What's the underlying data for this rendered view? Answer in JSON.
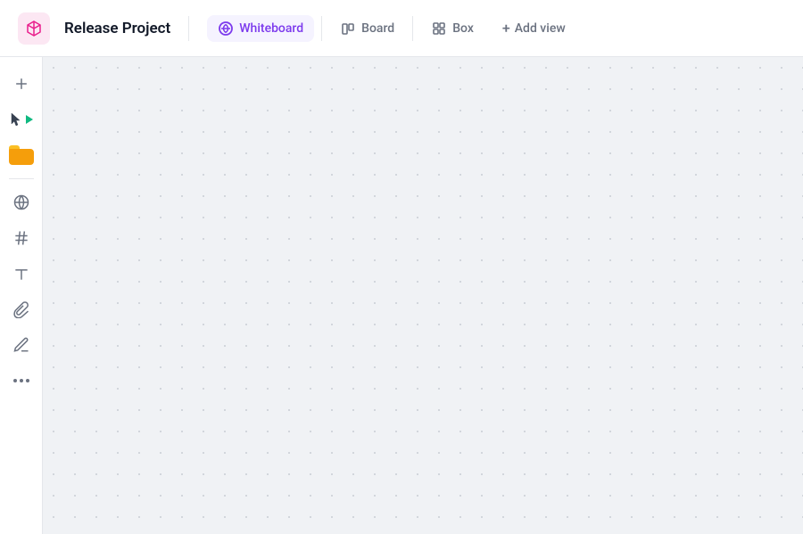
{
  "header": {
    "project_icon_alt": "release-project-icon",
    "project_title": "Release Project",
    "tabs": [
      {
        "id": "whiteboard",
        "label": "Whiteboard",
        "active": true
      },
      {
        "id": "board",
        "label": "Board",
        "active": false
      },
      {
        "id": "box",
        "label": "Box",
        "active": false
      }
    ],
    "add_view_label": "Add view"
  },
  "sidebar": {
    "tools": [
      {
        "id": "add",
        "icon": "plus-icon",
        "label": "+"
      },
      {
        "id": "cursor",
        "icon": "cursor-icon",
        "label": ""
      },
      {
        "id": "files",
        "icon": "folder-icon",
        "label": ""
      },
      {
        "id": "globe",
        "icon": "globe-icon",
        "label": ""
      },
      {
        "id": "hash",
        "icon": "hash-icon",
        "label": ""
      },
      {
        "id": "text",
        "icon": "text-icon",
        "label": "T"
      },
      {
        "id": "attach",
        "icon": "paperclip-icon",
        "label": ""
      },
      {
        "id": "draw",
        "icon": "pen-icon",
        "label": ""
      },
      {
        "id": "more",
        "icon": "more-icon",
        "label": "..."
      }
    ]
  },
  "canvas": {
    "background_color": "#f0f2f5",
    "dot_color": "#c8ccd4"
  },
  "colors": {
    "active_tab": "#7c3aed",
    "active_tab_bg": "#f5f3ff",
    "icon_stroke": "#6b7280",
    "border": "#e5e7eb",
    "header_bg": "#ffffff",
    "sidebar_bg": "#ffffff"
  }
}
